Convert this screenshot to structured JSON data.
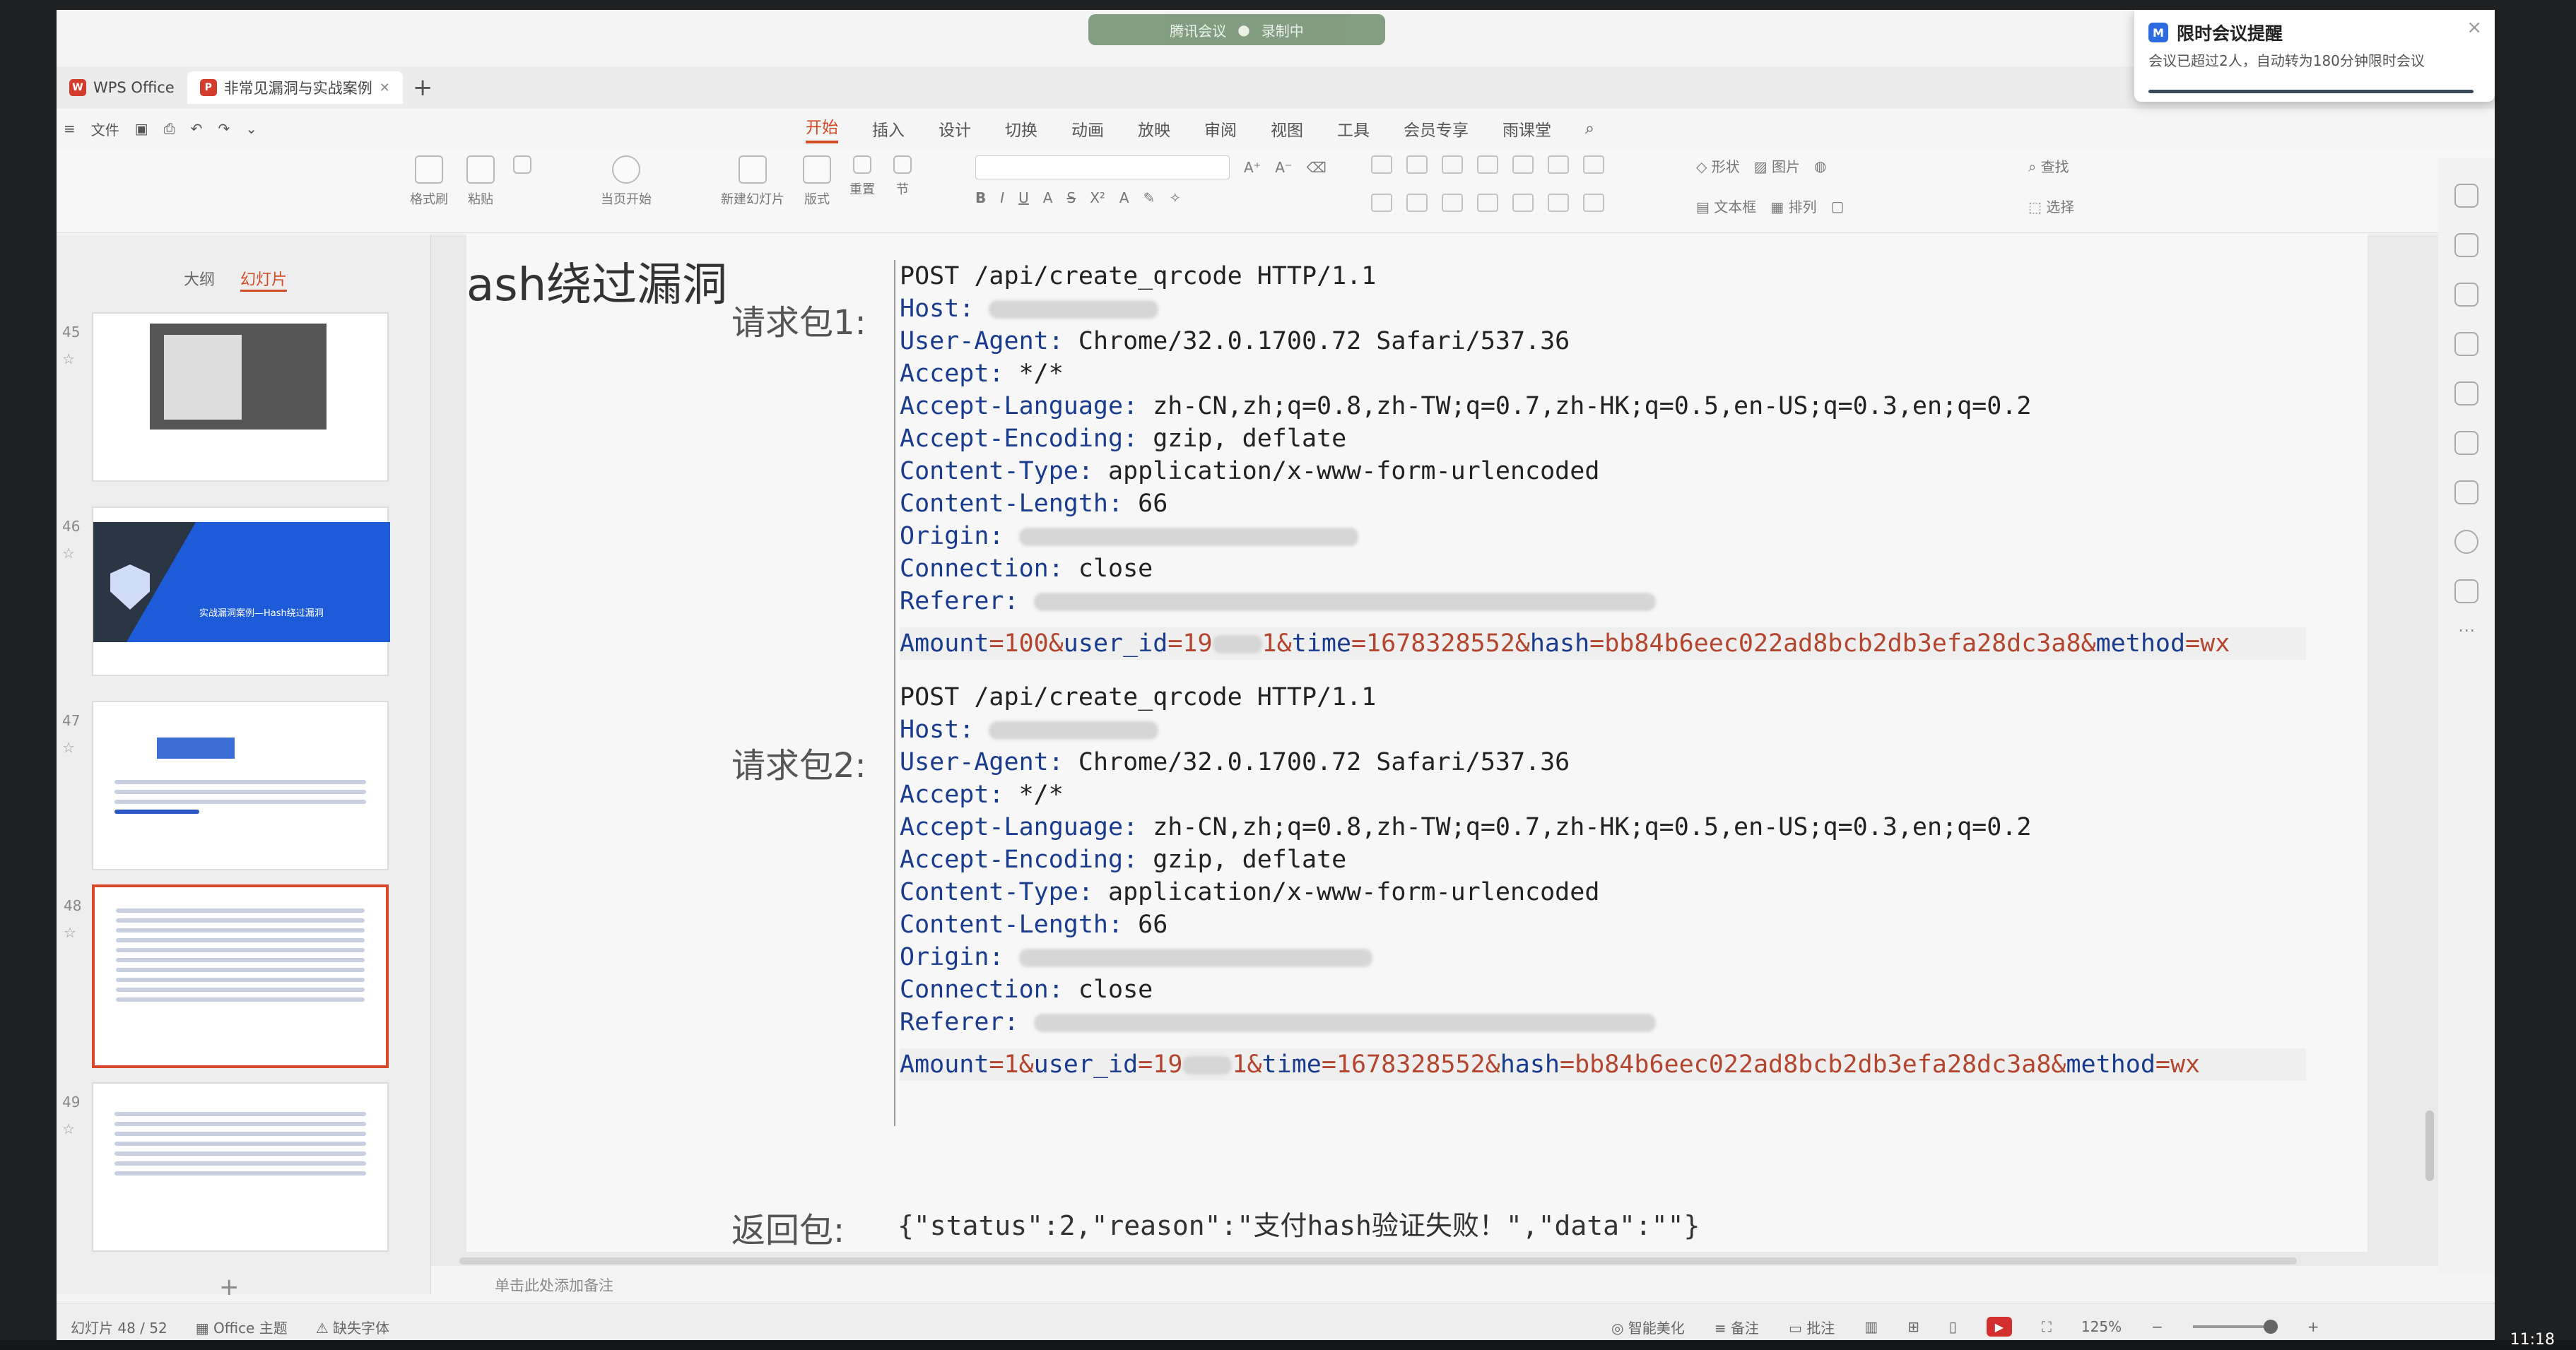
{
  "meeting_pill": {
    "label": "腾讯会议",
    "status": "录制中"
  },
  "tabs": [
    {
      "label": "WPS Office",
      "active": false
    },
    {
      "label": "非常见漏洞与实战案例",
      "active": true
    }
  ],
  "menu_left": {
    "file": "文件"
  },
  "ribbon_tabs": [
    "开始",
    "插入",
    "设计",
    "切换",
    "动画",
    "放映",
    "审阅",
    "视图",
    "工具",
    "会员专享",
    "雨课堂"
  ],
  "toolbar": {
    "format_painter": "格式刷",
    "paste": "粘贴",
    "play_from_current": "当页开始",
    "new_slide": "新建幻灯片",
    "layout": "版式",
    "section": "节",
    "reset": "重置",
    "shape": "形状",
    "textbox": "文本框",
    "picture": "图片",
    "arrange": "排列",
    "find": "查找",
    "select": "选择"
  },
  "notification": {
    "title": "限时会议提醒",
    "body": "会议已超过2人，自动转为180分钟限时会议"
  },
  "thumb_panel": {
    "tab_outline": "大纲",
    "tab_slides": "幻灯片",
    "thumbs": [
      {
        "num": "45"
      },
      {
        "num": "46",
        "caption": "实战漏洞案例—Hash绕过漏洞"
      },
      {
        "num": "47"
      },
      {
        "num": "48"
      },
      {
        "num": "49"
      }
    ]
  },
  "slide": {
    "title": "ash绕过漏洞",
    "req1_label": "请求包1:",
    "req2_label": "请求包2:",
    "resp_label": "返回包:",
    "req1": {
      "request_line": "POST /api/create_qrcode HTTP/1.1",
      "host_key": "Host:",
      "ua_key": "User-Agent:",
      "ua_val": "Chrome/32.0.1700.72 Safari/537.36",
      "accept_key": "Accept:",
      "accept_val": "*/*",
      "lang_key": "Accept-Language:",
      "lang_val": "zh-CN,zh;q=0.8,zh-TW;q=0.7,zh-HK;q=0.5,en-US;q=0.3,en;q=0.2",
      "enc_key": "Accept-Encoding:",
      "enc_val": "gzip, deflate",
      "ctype_key": "Content-Type:",
      "ctype_val": "application/x-www-form-urlencoded",
      "clen_key": "Content-Length:",
      "clen_val": "66",
      "origin_key": "Origin:",
      "conn_key": "Connection:",
      "conn_val": "close",
      "referer_key": "Referer:",
      "body_amount_key": "Amount",
      "body_amount_val": "=100&",
      "body_user_key": "user_id",
      "body_user_val": "=19",
      "body_user_tail": "1&",
      "body_time_key": "time",
      "body_time_val": "=1678328552&",
      "body_hash_key": "hash",
      "body_hash_val": "=bb84b6eec022ad8bcb2db3efa28dc3a8&",
      "body_method_key": "method",
      "body_method_val": "=wx"
    },
    "req2": {
      "request_line": "POST /api/create_qrcode HTTP/1.1",
      "host_key": "Host:",
      "ua_key": "User-Agent:",
      "ua_val": "Chrome/32.0.1700.72 Safari/537.36",
      "accept_key": "Accept:",
      "accept_val": "*/*",
      "lang_key": "Accept-Language:",
      "lang_val": "zh-CN,zh;q=0.8,zh-TW;q=0.7,zh-HK;q=0.5,en-US;q=0.3,en;q=0.2",
      "enc_key": "Accept-Encoding:",
      "enc_val": "gzip, deflate",
      "ctype_key": "Content-Type:",
      "ctype_val": "application/x-www-form-urlencoded",
      "clen_key": "Content-Length:",
      "clen_val": "66",
      "origin_key": "Origin:",
      "conn_key": "Connection:",
      "conn_val": "close",
      "referer_key": "Referer:",
      "body_amount_key": "Amount",
      "body_amount_val": "=1&",
      "body_user_key": "user_id",
      "body_user_val": "=19",
      "body_user_tail": "1&",
      "body_time_key": "time",
      "body_time_val": "=1678328552&",
      "body_hash_key": "hash",
      "body_hash_val": "=bb84b6eec022ad8bcb2db3efa28dc3a8&",
      "body_method_key": "method",
      "body_method_val": "=wx"
    },
    "response": "{\"status\":2,\"reason\":\"支付hash验证失败！\",\"data\":\"\"}"
  },
  "notes_placeholder": "单击此处添加备注",
  "status": {
    "slide_counter": "幻灯片 48 / 52",
    "theme": "Office 主题",
    "missing_font": "缺失字体",
    "smart_beautify": "智能美化",
    "notes": "备注",
    "comments": "批注",
    "zoom": "125%",
    "clock": "11:18"
  }
}
